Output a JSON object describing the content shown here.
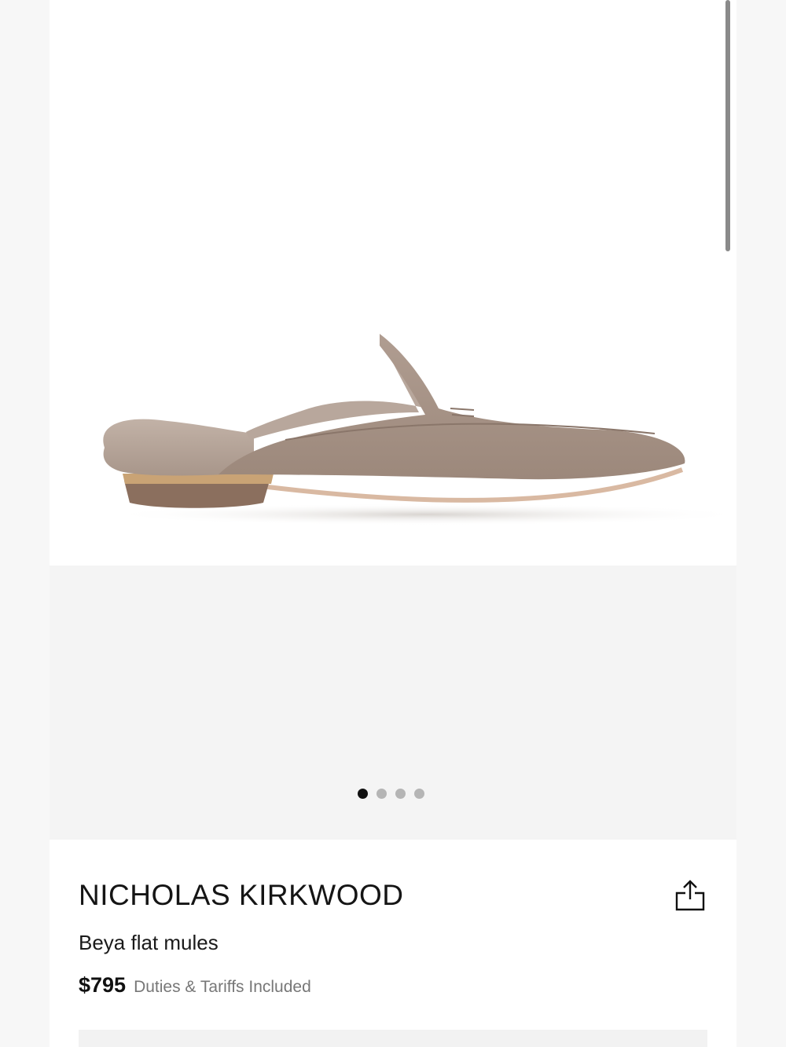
{
  "gallery": {
    "image_alt": "Beya flat mules suede slipper",
    "total_slides": 4,
    "current_slide": 1
  },
  "product": {
    "brand": "NICHOLAS KIRKWOOD",
    "name": "Beya flat mules",
    "price": "$795",
    "duties_note": "Duties & Tariffs Included"
  },
  "icons": {
    "share": "share-icon"
  },
  "colors": {
    "suede": "#a79487",
    "fur": "#b6a59a",
    "heel_gold": "#c9a375",
    "heel": "#8b6f5e"
  }
}
